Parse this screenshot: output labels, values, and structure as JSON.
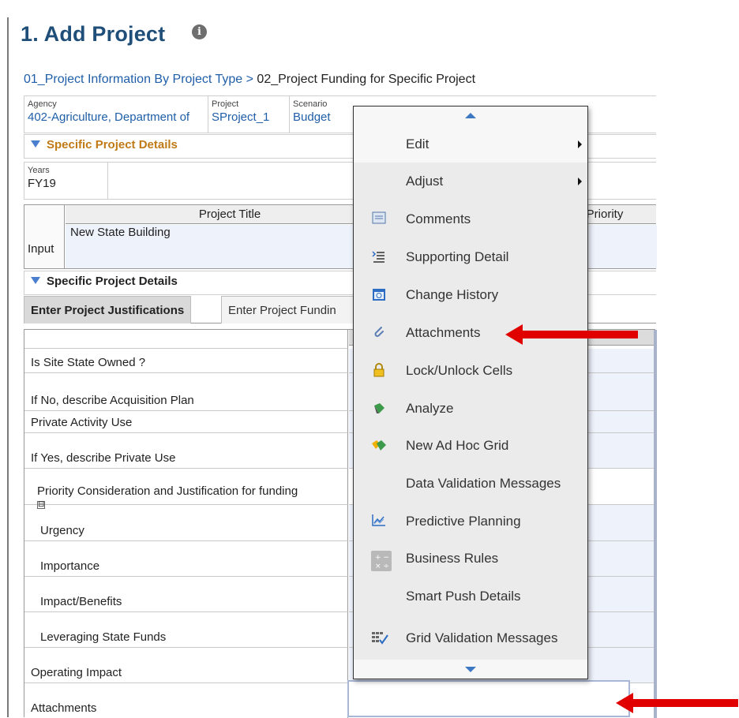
{
  "page": {
    "title": "1. Add Project",
    "info_icon": "info-icon"
  },
  "breadcrumb": {
    "link": "01_Project Information By Project Type",
    "separator": " > ",
    "current": "02_Project Funding for Specific Project"
  },
  "pov": {
    "agency_label": "Agency",
    "agency_value": "402-Agriculture, Department of",
    "project_label": "Project",
    "project_value": "SProject_1",
    "scenario_label": "Scenario",
    "scenario_value": "Budget"
  },
  "sections": {
    "first": "Specific Project Details",
    "second": "Specific Project Details"
  },
  "years": {
    "label": "Years",
    "value": "FY19"
  },
  "project_grid": {
    "col_title": "Project Title",
    "col_priority_partial": "y Priority",
    "row_label": "Input",
    "title_value": "New State Building"
  },
  "tabs": [
    {
      "label": "Enter Project Justifications",
      "active": true
    },
    {
      "label": "Enter Project Fundin",
      "active": false
    }
  ],
  "grid_rows": [
    {
      "label": "Is Site State Owned ?",
      "indent": false
    },
    {
      "label": "If No, describe Acquisition Plan",
      "indent": false
    },
    {
      "label": "Private Activity Use",
      "indent": false
    },
    {
      "label": "If Yes, describe Private Use",
      "indent": false
    },
    {
      "label": "Priority Consideration and Justification for funding",
      "indent": false,
      "expander": "⊟"
    },
    {
      "label": "Urgency",
      "indent": true
    },
    {
      "label": "Importance",
      "indent": true
    },
    {
      "label": "Impact/Benefits",
      "indent": true
    },
    {
      "label": "Leveraging State Funds",
      "indent": true
    },
    {
      "label": "Operating Impact",
      "indent": false
    },
    {
      "label": "Attachments",
      "indent": false
    }
  ],
  "context_menu": {
    "items": [
      {
        "label": "Edit",
        "icon": "none",
        "submenu": true
      },
      {
        "label": "Adjust",
        "icon": "none",
        "submenu": true
      },
      {
        "label": "Comments",
        "icon": "comments-icon"
      },
      {
        "label": "Supporting Detail",
        "icon": "supporting-detail-icon"
      },
      {
        "label": "Change History",
        "icon": "change-history-icon"
      },
      {
        "label": "Attachments",
        "icon": "paperclip-icon"
      },
      {
        "label": "Lock/Unlock Cells",
        "icon": "lock-icon"
      },
      {
        "label": "Analyze",
        "icon": "analyze-icon"
      },
      {
        "label": "New Ad Hoc Grid",
        "icon": "ad-hoc-grid-icon"
      },
      {
        "label": "Data Validation Messages",
        "icon": "none"
      },
      {
        "label": "Predictive Planning",
        "icon": "predictive-planning-icon"
      },
      {
        "label": "Business Rules",
        "icon": "business-rules-icon"
      },
      {
        "label": "Smart Push Details",
        "icon": "none"
      },
      {
        "label": "Grid Validation Messages",
        "icon": "grid-validation-icon"
      }
    ]
  },
  "colors": {
    "title": "#1f4e79",
    "link": "#1f5ea8",
    "section_orange": "#c07a16",
    "annotation_red": "#e00000",
    "menu_bg": "#ebebeb"
  }
}
